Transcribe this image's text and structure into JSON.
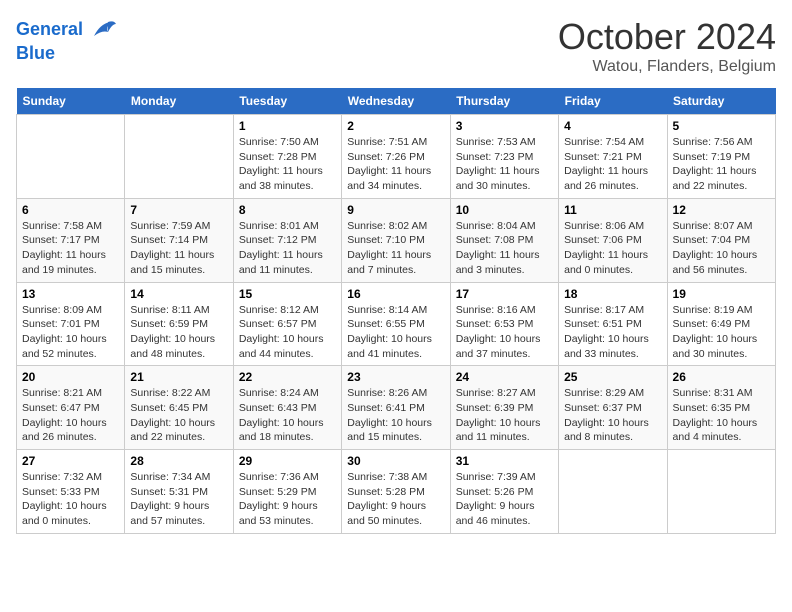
{
  "header": {
    "logo_line1": "General",
    "logo_line2": "Blue",
    "month_title": "October 2024",
    "location": "Watou, Flanders, Belgium"
  },
  "weekdays": [
    "Sunday",
    "Monday",
    "Tuesday",
    "Wednesday",
    "Thursday",
    "Friday",
    "Saturday"
  ],
  "weeks": [
    [
      {
        "day": "",
        "sunrise": "",
        "sunset": "",
        "daylight": ""
      },
      {
        "day": "",
        "sunrise": "",
        "sunset": "",
        "daylight": ""
      },
      {
        "day": "1",
        "sunrise": "Sunrise: 7:50 AM",
        "sunset": "Sunset: 7:28 PM",
        "daylight": "Daylight: 11 hours and 38 minutes."
      },
      {
        "day": "2",
        "sunrise": "Sunrise: 7:51 AM",
        "sunset": "Sunset: 7:26 PM",
        "daylight": "Daylight: 11 hours and 34 minutes."
      },
      {
        "day": "3",
        "sunrise": "Sunrise: 7:53 AM",
        "sunset": "Sunset: 7:23 PM",
        "daylight": "Daylight: 11 hours and 30 minutes."
      },
      {
        "day": "4",
        "sunrise": "Sunrise: 7:54 AM",
        "sunset": "Sunset: 7:21 PM",
        "daylight": "Daylight: 11 hours and 26 minutes."
      },
      {
        "day": "5",
        "sunrise": "Sunrise: 7:56 AM",
        "sunset": "Sunset: 7:19 PM",
        "daylight": "Daylight: 11 hours and 22 minutes."
      }
    ],
    [
      {
        "day": "6",
        "sunrise": "Sunrise: 7:58 AM",
        "sunset": "Sunset: 7:17 PM",
        "daylight": "Daylight: 11 hours and 19 minutes."
      },
      {
        "day": "7",
        "sunrise": "Sunrise: 7:59 AM",
        "sunset": "Sunset: 7:14 PM",
        "daylight": "Daylight: 11 hours and 15 minutes."
      },
      {
        "day": "8",
        "sunrise": "Sunrise: 8:01 AM",
        "sunset": "Sunset: 7:12 PM",
        "daylight": "Daylight: 11 hours and 11 minutes."
      },
      {
        "day": "9",
        "sunrise": "Sunrise: 8:02 AM",
        "sunset": "Sunset: 7:10 PM",
        "daylight": "Daylight: 11 hours and 7 minutes."
      },
      {
        "day": "10",
        "sunrise": "Sunrise: 8:04 AM",
        "sunset": "Sunset: 7:08 PM",
        "daylight": "Daylight: 11 hours and 3 minutes."
      },
      {
        "day": "11",
        "sunrise": "Sunrise: 8:06 AM",
        "sunset": "Sunset: 7:06 PM",
        "daylight": "Daylight: 11 hours and 0 minutes."
      },
      {
        "day": "12",
        "sunrise": "Sunrise: 8:07 AM",
        "sunset": "Sunset: 7:04 PM",
        "daylight": "Daylight: 10 hours and 56 minutes."
      }
    ],
    [
      {
        "day": "13",
        "sunrise": "Sunrise: 8:09 AM",
        "sunset": "Sunset: 7:01 PM",
        "daylight": "Daylight: 10 hours and 52 minutes."
      },
      {
        "day": "14",
        "sunrise": "Sunrise: 8:11 AM",
        "sunset": "Sunset: 6:59 PM",
        "daylight": "Daylight: 10 hours and 48 minutes."
      },
      {
        "day": "15",
        "sunrise": "Sunrise: 8:12 AM",
        "sunset": "Sunset: 6:57 PM",
        "daylight": "Daylight: 10 hours and 44 minutes."
      },
      {
        "day": "16",
        "sunrise": "Sunrise: 8:14 AM",
        "sunset": "Sunset: 6:55 PM",
        "daylight": "Daylight: 10 hours and 41 minutes."
      },
      {
        "day": "17",
        "sunrise": "Sunrise: 8:16 AM",
        "sunset": "Sunset: 6:53 PM",
        "daylight": "Daylight: 10 hours and 37 minutes."
      },
      {
        "day": "18",
        "sunrise": "Sunrise: 8:17 AM",
        "sunset": "Sunset: 6:51 PM",
        "daylight": "Daylight: 10 hours and 33 minutes."
      },
      {
        "day": "19",
        "sunrise": "Sunrise: 8:19 AM",
        "sunset": "Sunset: 6:49 PM",
        "daylight": "Daylight: 10 hours and 30 minutes."
      }
    ],
    [
      {
        "day": "20",
        "sunrise": "Sunrise: 8:21 AM",
        "sunset": "Sunset: 6:47 PM",
        "daylight": "Daylight: 10 hours and 26 minutes."
      },
      {
        "day": "21",
        "sunrise": "Sunrise: 8:22 AM",
        "sunset": "Sunset: 6:45 PM",
        "daylight": "Daylight: 10 hours and 22 minutes."
      },
      {
        "day": "22",
        "sunrise": "Sunrise: 8:24 AM",
        "sunset": "Sunset: 6:43 PM",
        "daylight": "Daylight: 10 hours and 18 minutes."
      },
      {
        "day": "23",
        "sunrise": "Sunrise: 8:26 AM",
        "sunset": "Sunset: 6:41 PM",
        "daylight": "Daylight: 10 hours and 15 minutes."
      },
      {
        "day": "24",
        "sunrise": "Sunrise: 8:27 AM",
        "sunset": "Sunset: 6:39 PM",
        "daylight": "Daylight: 10 hours and 11 minutes."
      },
      {
        "day": "25",
        "sunrise": "Sunrise: 8:29 AM",
        "sunset": "Sunset: 6:37 PM",
        "daylight": "Daylight: 10 hours and 8 minutes."
      },
      {
        "day": "26",
        "sunrise": "Sunrise: 8:31 AM",
        "sunset": "Sunset: 6:35 PM",
        "daylight": "Daylight: 10 hours and 4 minutes."
      }
    ],
    [
      {
        "day": "27",
        "sunrise": "Sunrise: 7:32 AM",
        "sunset": "Sunset: 5:33 PM",
        "daylight": "Daylight: 10 hours and 0 minutes."
      },
      {
        "day": "28",
        "sunrise": "Sunrise: 7:34 AM",
        "sunset": "Sunset: 5:31 PM",
        "daylight": "Daylight: 9 hours and 57 minutes."
      },
      {
        "day": "29",
        "sunrise": "Sunrise: 7:36 AM",
        "sunset": "Sunset: 5:29 PM",
        "daylight": "Daylight: 9 hours and 53 minutes."
      },
      {
        "day": "30",
        "sunrise": "Sunrise: 7:38 AM",
        "sunset": "Sunset: 5:28 PM",
        "daylight": "Daylight: 9 hours and 50 minutes."
      },
      {
        "day": "31",
        "sunrise": "Sunrise: 7:39 AM",
        "sunset": "Sunset: 5:26 PM",
        "daylight": "Daylight: 9 hours and 46 minutes."
      },
      {
        "day": "",
        "sunrise": "",
        "sunset": "",
        "daylight": ""
      },
      {
        "day": "",
        "sunrise": "",
        "sunset": "",
        "daylight": ""
      }
    ]
  ]
}
